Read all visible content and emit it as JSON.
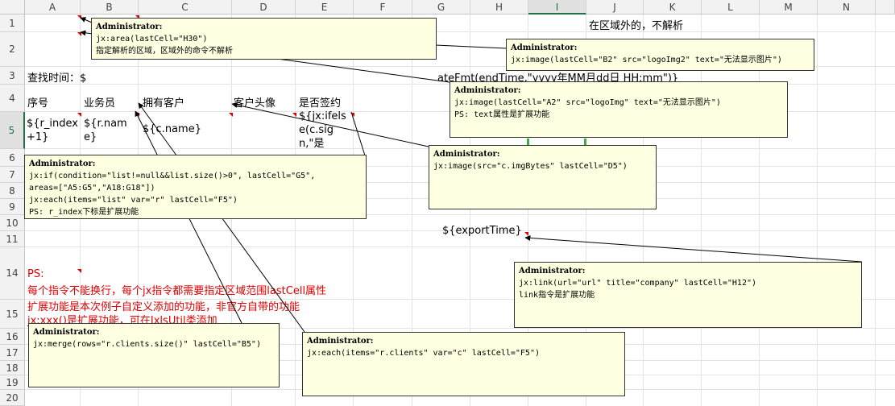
{
  "columns": [
    "A",
    "B",
    "C",
    "D",
    "E",
    "F",
    "G",
    "H",
    "I",
    "J",
    "K",
    "L",
    "M",
    "N"
  ],
  "selected_column": "I",
  "rows": [
    "1",
    "2",
    "3",
    "4",
    "5",
    "6",
    "7",
    "8",
    "9",
    "10",
    "11",
    "14",
    "15",
    "16",
    "17",
    "18",
    "19",
    "20"
  ],
  "selected_row": "5",
  "cells": {
    "j1": "在区域外的，不解析",
    "a3": "查找时间：$",
    "g3_tail": "ateFmt(endTime,\"yyyy年MM月dd日 HH:mm\")}",
    "a4": "序号",
    "b4": "业务员",
    "c4": "拥有客户",
    "d4": "客户头像",
    "e4": "是否签约",
    "a5": "${r_index+1}",
    "b5": "${r.name}",
    "c5": "${c.name}",
    "e5": "${jx:ifelse(c.sign,\"是",
    "h11": "${exportTime}",
    "ps_title": "PS:",
    "ps_line1": "每个指令不能换行，每个jx指令都需要指定区域范围lastCell属性",
    "ps_line2": "扩展功能是本次例子自定义添加的功能，非官方自带的功能",
    "ps_line3": "jx:xxx()是扩展功能，可在JxlsUtil类添加"
  },
  "notes": {
    "area": {
      "author": "Administrator:",
      "lines": [
        "jx:area(lastCell=\"H30\")",
        "指定解析的区域，区域外的命令不解析"
      ]
    },
    "image_b2": {
      "author": "Administrator:",
      "lines": [
        "jx:image(lastCell=\"B2\" src=\"logoImg2\" text=\"无法显示图片\")"
      ]
    },
    "image_a2": {
      "author": "Administrator:",
      "lines": [
        "jx:image(lastCell=\"A2\" src=\"logoImg\" text=\"无法显示图片\")",
        "PS: text属性是扩展功能"
      ]
    },
    "if_each": {
      "author": "Administrator:",
      "lines": [
        "jx:if(condition=\"list!=null&&list.size()>0\", lastCell=\"G5\",",
        "areas=[\"A5:G5\",\"A18:G18\"])",
        "jx:each(items=\"list\" var=\"r\" lastCell=\"F5\")",
        "PS: r_index下标是扩展功能"
      ]
    },
    "image_d5": {
      "author": "Administrator:",
      "lines": [
        "jx:image(src=\"c.imgBytes\" lastCell=\"D5\")"
      ]
    },
    "link": {
      "author": "Administrator:",
      "lines": [
        "jx:link(url=\"url\" title=\"company\" lastCell=\"H12\")",
        "link指令是扩展功能"
      ]
    },
    "merge": {
      "author": "Administrator:",
      "lines": [
        "jx:merge(rows=\"r.clients.size()\" lastCell=\"B5\")"
      ]
    },
    "each_clients": {
      "author": "Administrator:",
      "lines": [
        "jx:each(items=\"r.clients\" var=\"c\" lastCell=\"F5\")"
      ]
    }
  },
  "colors": {
    "accent_green": "#217346",
    "comment_bg": "#ffffe1",
    "comment_marker": "#e00000",
    "ps_text": "#e00000"
  }
}
